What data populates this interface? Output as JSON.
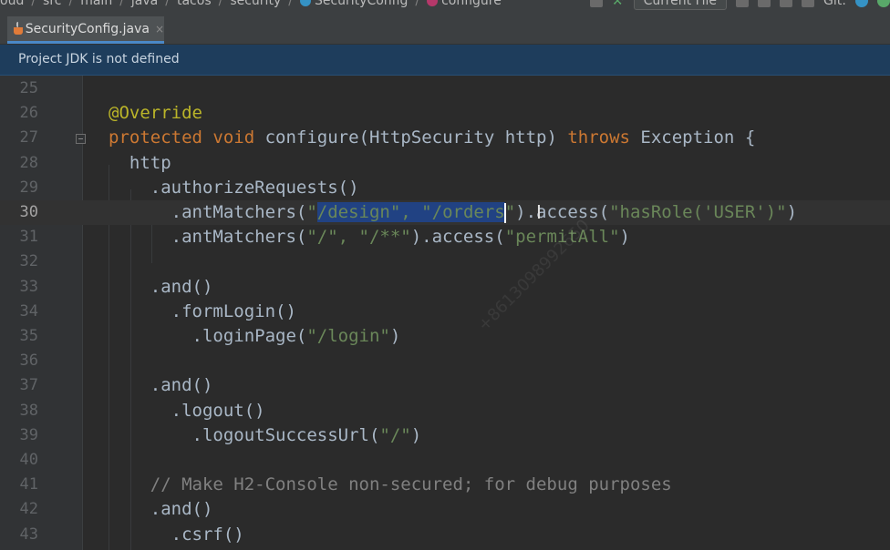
{
  "breadcrumb": [
    "oud",
    "src",
    "main",
    "java",
    "tacos",
    "security",
    "SecurityConfig",
    "configure"
  ],
  "toolbar": {
    "run_config": "Current File",
    "git_label": "Git:"
  },
  "tab": {
    "label": "SecurityConfig.java",
    "close": "×"
  },
  "banner": {
    "text": "Project JDK is not defined"
  },
  "watermark": "+8613098992650",
  "colors": {
    "keyword": "#cc7832",
    "annotation": "#bbb529",
    "string": "#6a8759",
    "comment": "#808080",
    "selection": "#214283",
    "banner": "#1e3d5c"
  },
  "editor": {
    "current_line": 30,
    "lines": [
      {
        "n": "25",
        "segments": []
      },
      {
        "n": "26",
        "segments": [
          {
            "t": "@Override",
            "k": "ann"
          }
        ]
      },
      {
        "n": "27",
        "segments": [
          {
            "t": "protected",
            "k": "kw"
          },
          {
            "t": " "
          },
          {
            "t": "void",
            "k": "kw"
          },
          {
            "t": " configure(HttpSecurity http) "
          },
          {
            "t": "throws",
            "k": "kw"
          },
          {
            "t": " Exception {"
          }
        ]
      },
      {
        "n": "28",
        "segments": [
          {
            "t": "  http"
          }
        ]
      },
      {
        "n": "29",
        "segments": [
          {
            "t": "    .authorizeRequests()"
          }
        ]
      },
      {
        "n": "30",
        "segments": [
          {
            "t": "      .antMatchers("
          },
          {
            "t": "\"",
            "k": "str"
          },
          {
            "t": "/design\", \"/orders",
            "k": "str",
            "sel": true
          },
          {
            "caret": true
          },
          {
            "t": "\"",
            "k": "str"
          },
          {
            "t": ").access("
          },
          {
            "t": "\"hasRole('USER')\"",
            "k": "str"
          },
          {
            "t": ")"
          }
        ]
      },
      {
        "n": "31",
        "segments": [
          {
            "t": "      .antMatchers("
          },
          {
            "t": "\"/\", \"/**\"",
            "k": "str"
          },
          {
            "t": ").access("
          },
          {
            "t": "\"permitAll\"",
            "k": "str"
          },
          {
            "t": ")"
          }
        ]
      },
      {
        "n": "32",
        "segments": []
      },
      {
        "n": "33",
        "segments": [
          {
            "t": "    .and()"
          }
        ]
      },
      {
        "n": "34",
        "segments": [
          {
            "t": "      .formLogin()"
          }
        ]
      },
      {
        "n": "35",
        "segments": [
          {
            "t": "        .loginPage("
          },
          {
            "t": "\"/login\"",
            "k": "str"
          },
          {
            "t": ")"
          }
        ]
      },
      {
        "n": "36",
        "segments": []
      },
      {
        "n": "37",
        "segments": [
          {
            "t": "    .and()"
          }
        ]
      },
      {
        "n": "38",
        "segments": [
          {
            "t": "      .logout()"
          }
        ]
      },
      {
        "n": "39",
        "segments": [
          {
            "t": "        .logoutSuccessUrl("
          },
          {
            "t": "\"/\"",
            "k": "str"
          },
          {
            "t": ")"
          }
        ]
      },
      {
        "n": "40",
        "segments": []
      },
      {
        "n": "41",
        "segments": [
          {
            "t": "    // Make H2-Console non-secured; for debug purposes",
            "k": "cm"
          }
        ]
      },
      {
        "n": "42",
        "segments": [
          {
            "t": "    .and()"
          }
        ]
      },
      {
        "n": "43",
        "segments": [
          {
            "t": "      .csrf()"
          }
        ]
      }
    ]
  }
}
